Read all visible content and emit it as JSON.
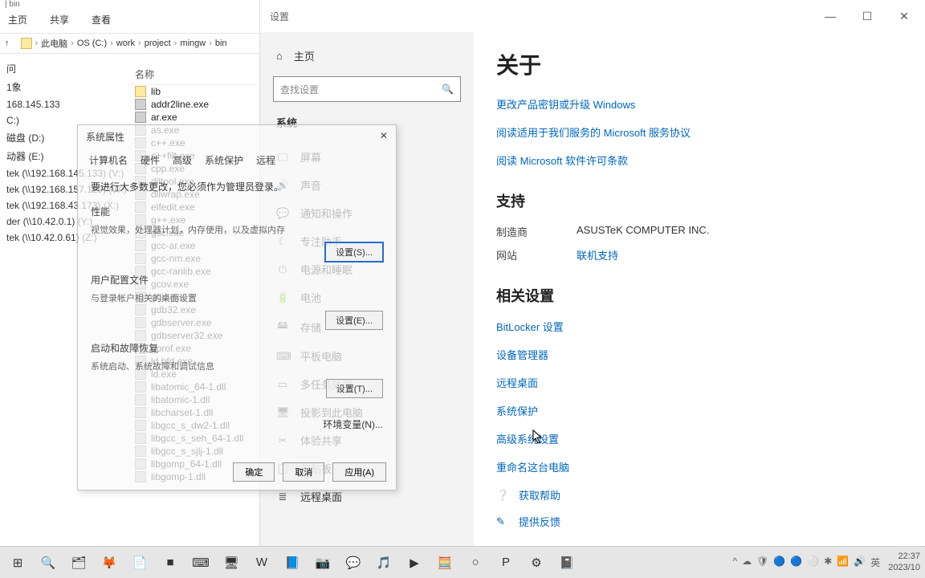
{
  "explorer": {
    "title": "  |  bin",
    "tabs": [
      "主页",
      "共享",
      "查看"
    ],
    "path_up": "↑",
    "breadcrumb": [
      "此电脑",
      "OS (C:)",
      "work",
      "project",
      "mingw",
      "bin"
    ],
    "col_name": "名称",
    "tree": {
      "items": [
        "问",
        "1象",
        "168.145.133",
        "C:)",
        "磁盘 (D:)",
        "动器 (E:)",
        "tek (\\\\192.168.145.133) (V:)",
        "tek (\\\\192.168.157.129) (W:)",
        "tek (\\\\192.168.43.173) (X:)",
        "der (\\\\10.42.0.1) (Y:)",
        "tek (\\\\10.42.0.61) (Z:)"
      ]
    },
    "files": [
      {
        "name": "lib",
        "type": "folder"
      },
      {
        "name": "addr2line.exe",
        "type": "exe"
      },
      {
        "name": "ar.exe",
        "type": "exe"
      },
      {
        "name": "as.exe",
        "type": "exe"
      },
      {
        "name": "c++.exe",
        "type": "exe"
      },
      {
        "name": "c++filt.exe",
        "type": "exe"
      },
      {
        "name": "cpp.exe",
        "type": "exe"
      },
      {
        "name": "dlltool.exe",
        "type": "exe"
      },
      {
        "name": "dllwrap.exe",
        "type": "exe"
      },
      {
        "name": "elfedit.exe",
        "type": "exe"
      },
      {
        "name": "g++.exe",
        "type": "exe"
      },
      {
        "name": "gcc.exe",
        "type": "exe"
      },
      {
        "name": "gcc-ar.exe",
        "type": "exe"
      },
      {
        "name": "gcc-nm.exe",
        "type": "exe"
      },
      {
        "name": "gcc-ranlib.exe",
        "type": "exe"
      },
      {
        "name": "gcov.exe",
        "type": "exe"
      },
      {
        "name": "gdb.exe",
        "type": "exe"
      },
      {
        "name": "gdb32.exe",
        "type": "exe"
      },
      {
        "name": "gdbserver.exe",
        "type": "exe"
      },
      {
        "name": "gdbserver32.exe",
        "type": "exe"
      },
      {
        "name": "gprof.exe",
        "type": "exe"
      },
      {
        "name": "ld.bfd.exe",
        "type": "exe"
      },
      {
        "name": "ld.exe",
        "type": "exe"
      },
      {
        "name": "libatomic_64-1.dll",
        "type": "dll"
      },
      {
        "name": "libatomic-1.dll",
        "type": "dll"
      },
      {
        "name": "libcharset-1.dll",
        "type": "dll"
      },
      {
        "name": "libgcc_s_dw2-1.dll",
        "type": "dll"
      },
      {
        "name": "libgcc_s_seh_64-1.dll",
        "type": "dll"
      },
      {
        "name": "libgcc_s_sjlj-1.dll",
        "type": "dll"
      },
      {
        "name": "libgomp_64-1.dll",
        "type": "dll"
      },
      {
        "name": "libgomp-1.dll",
        "type": "dll"
      }
    ]
  },
  "settings": {
    "title": "设置",
    "home": "主页",
    "search_placeholder": "查找设置",
    "section": "系统",
    "nav": [
      {
        "icon": "🖵",
        "label": "屏幕"
      },
      {
        "icon": "🔊",
        "label": "声音"
      },
      {
        "icon": "💬",
        "label": "通知和操作"
      },
      {
        "icon": "☾",
        "label": "专注助手"
      },
      {
        "icon": "⏻",
        "label": "电源和睡眠"
      },
      {
        "icon": "🔋",
        "label": "电池"
      },
      {
        "icon": "🖴",
        "label": "存储"
      },
      {
        "icon": "⌨",
        "label": "平板电脑"
      },
      {
        "icon": "▭",
        "label": "多任务处理"
      },
      {
        "icon": "🖥",
        "label": "投影到此电脑"
      },
      {
        "icon": "✂",
        "label": "体验共享"
      },
      {
        "icon": "📋",
        "label": "剪贴板"
      },
      {
        "icon": "≣",
        "label": "远程桌面"
      }
    ],
    "main": {
      "heading": "关于",
      "links_top": [
        "更改产品密钥或升级 Windows",
        "阅读适用于我们服务的 Microsoft 服务协议",
        "阅读 Microsoft 软件许可条款"
      ],
      "support_heading": "支持",
      "support": {
        "mfr_label": "制造商",
        "mfr_value": "ASUSTeK COMPUTER INC.",
        "site_label": "网站",
        "site_value": "联机支持"
      },
      "related_heading": "相关设置",
      "related": [
        "BitLocker 设置",
        "设备管理器",
        "远程桌面",
        "系统保护",
        "高级系统设置",
        "重命名这台电脑"
      ],
      "help_label": "获取帮助",
      "feedback_label": "提供反馈"
    }
  },
  "sysprop": {
    "title": "系统属性",
    "close": "✕",
    "tabs": [
      "计算机名",
      "硬件",
      "高级",
      "系统保护",
      "远程"
    ],
    "note": "要进行大多数更改，您必须作为管理员登录。",
    "g1": {
      "title": "性能",
      "desc": "视觉效果，处理器计划，内存使用，以及虚拟内存",
      "btn": "设置(S)..."
    },
    "g2": {
      "title": "用户配置文件",
      "desc": "与登录帐户相关的桌面设置",
      "btn": "设置(E)..."
    },
    "g3": {
      "title": "启动和故障恢复",
      "desc": "系统启动、系统故障和调试信息",
      "btn": "设置(T)..."
    },
    "env_btn": "环境变量(N)...",
    "ok": "确定",
    "cancel": "取消",
    "apply": "应用(A)"
  },
  "taskbar": {
    "icons": [
      "⊞",
      "🔍",
      "🗂",
      "🦊",
      "📄",
      "■",
      "⌨",
      "🖥",
      "W",
      "📘",
      "📷",
      "💬",
      "🎵",
      "▶",
      "🧮",
      "○",
      "P",
      "⚙",
      "📓"
    ],
    "tray": [
      "^",
      "☁",
      "🛡",
      "🔵",
      "🔵",
      "⚪",
      "✱",
      "📶",
      "🔊",
      "英"
    ],
    "time": "22:37",
    "date": "2023/10"
  }
}
